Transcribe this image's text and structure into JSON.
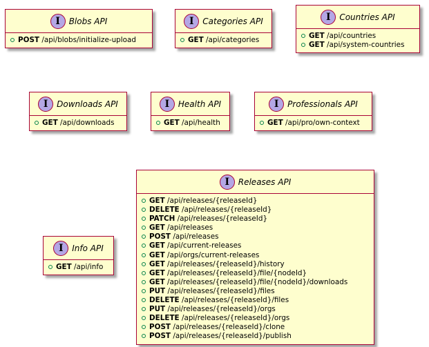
{
  "interfaces": [
    {
      "id": "blobs",
      "icon": "I",
      "title": "Blobs API",
      "ops": [
        {
          "verb": "POST",
          "path": "/api/blobs/initialize-upload"
        }
      ]
    },
    {
      "id": "categories",
      "icon": "I",
      "title": "Categories API",
      "ops": [
        {
          "verb": "GET",
          "path": "/api/categories"
        }
      ]
    },
    {
      "id": "countries",
      "icon": "I",
      "title": "Countries API",
      "ops": [
        {
          "verb": "GET",
          "path": "/api/countries"
        },
        {
          "verb": "GET",
          "path": "/api/system-countries"
        }
      ]
    },
    {
      "id": "downloads",
      "icon": "I",
      "title": "Downloads API",
      "ops": [
        {
          "verb": "GET",
          "path": "/api/downloads"
        }
      ]
    },
    {
      "id": "health",
      "icon": "I",
      "title": "Health API",
      "ops": [
        {
          "verb": "GET",
          "path": "/api/health"
        }
      ]
    },
    {
      "id": "professionals",
      "icon": "I",
      "title": "Professionals API",
      "ops": [
        {
          "verb": "GET",
          "path": "/api/pro/own-context"
        }
      ]
    },
    {
      "id": "info",
      "icon": "I",
      "title": "Info API",
      "ops": [
        {
          "verb": "GET",
          "path": "/api/info"
        }
      ]
    },
    {
      "id": "releases",
      "icon": "I",
      "title": "Releases API",
      "ops": [
        {
          "verb": "GET",
          "path": "/api/releases/{releaseId}"
        },
        {
          "verb": "DELETE",
          "path": "/api/releases/{releaseId}"
        },
        {
          "verb": "PATCH",
          "path": "/api/releases/{releaseId}"
        },
        {
          "verb": "GET",
          "path": "/api/releases"
        },
        {
          "verb": "POST",
          "path": "/api/releases"
        },
        {
          "verb": "GET",
          "path": "/api/current-releases"
        },
        {
          "verb": "GET",
          "path": "/api/orgs/current-releases"
        },
        {
          "verb": "GET",
          "path": "/api/releases/{releaseId}/history"
        },
        {
          "verb": "GET",
          "path": "/api/releases/{releaseId}/file/{nodeId}"
        },
        {
          "verb": "GET",
          "path": "/api/releases/{releaseId}/file/{nodeId}/downloads"
        },
        {
          "verb": "PUT",
          "path": "/api/releases/{releaseId}/files"
        },
        {
          "verb": "DELETE",
          "path": "/api/releases/{releaseId}/files"
        },
        {
          "verb": "PUT",
          "path": "/api/releases/{releaseId}/orgs"
        },
        {
          "verb": "DELETE",
          "path": "/api/releases/{releaseId}/orgs"
        },
        {
          "verb": "POST",
          "path": "/api/releases/{releaseId}/clone"
        },
        {
          "verb": "POST",
          "path": "/api/releases/{releaseId}/publish"
        }
      ]
    }
  ]
}
